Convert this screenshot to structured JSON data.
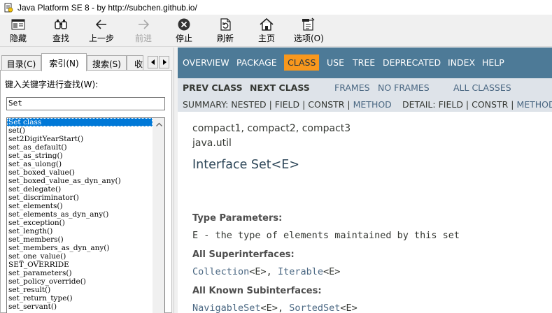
{
  "window": {
    "title": "Java Platform SE 8 - by http://subchen.github.io/"
  },
  "toolbar": {
    "buttons": [
      {
        "label": "隐藏",
        "icon": "hide-pane-icon",
        "enabled": true
      },
      {
        "label": "查找",
        "icon": "find-icon",
        "enabled": true
      },
      {
        "label": "上一步",
        "icon": "back-arrow-icon",
        "enabled": true
      },
      {
        "label": "前进",
        "icon": "forward-arrow-icon",
        "enabled": false
      },
      {
        "label": "停止",
        "icon": "stop-icon",
        "enabled": true
      },
      {
        "label": "刷新",
        "icon": "refresh-icon",
        "enabled": true
      },
      {
        "label": "主页",
        "icon": "home-icon",
        "enabled": true
      },
      {
        "label": "选项(O)",
        "icon": "options-icon",
        "enabled": true
      }
    ]
  },
  "left_pane": {
    "tabs": [
      {
        "label": "目录(C)",
        "active": false
      },
      {
        "label": "索引(N)",
        "active": true
      },
      {
        "label": "搜索(S)",
        "active": false
      },
      {
        "label": "收",
        "active": false
      }
    ],
    "keyword_label": "键入关键字进行查找(W):",
    "keyword_value": "Set",
    "index_items": [
      "Set class",
      "set()",
      "set2DigitYearStart()",
      "set_as_default()",
      "set_as_string()",
      "set_as_ulong()",
      "set_boxed_value()",
      "set_boxed_value_as_dyn_any()",
      "set_delegate()",
      "set_discriminator()",
      "set_elements()",
      "set_elements_as_dyn_any()",
      "set_exception()",
      "set_length()",
      "set_members()",
      "set_members_as_dyn_any()",
      "set_one_value()",
      "SET_OVERRIDE",
      "set_parameters()",
      "set_policy_override()",
      "set_result()",
      "set_return_type()",
      "set_servant()"
    ],
    "selected_index": 0
  },
  "doc": {
    "top_nav": [
      {
        "label": "OVERVIEW",
        "active": false
      },
      {
        "label": "PACKAGE",
        "active": false
      },
      {
        "label": "CLASS",
        "active": true
      },
      {
        "label": "USE",
        "active": false
      },
      {
        "label": "TREE",
        "active": false
      },
      {
        "label": "DEPRECATED",
        "active": false
      },
      {
        "label": "INDEX",
        "active": false
      },
      {
        "label": "HELP",
        "active": false
      }
    ],
    "sub_nav": {
      "prev_class": "PREV CLASS",
      "next_class": "NEXT CLASS",
      "frames": "FRAMES",
      "no_frames": "NO FRAMES",
      "all_classes": "ALL CLASSES",
      "summary_prefix": "SUMMARY: NESTED | FIELD | CONSTR |",
      "summary_method": "METHOD",
      "detail_prefix": "DETAIL: FIELD | CONSTR |",
      "detail_method": "METHOD"
    },
    "profiles": "compact1, compact2, compact3",
    "package": "java.util",
    "heading": "Interface Set<E>",
    "type_params_label": "Type Parameters:",
    "type_params_desc": "E - the type of elements maintained by this set",
    "superinterfaces_label": "All Superinterfaces:",
    "superinterfaces": [
      {
        "name": "Collection",
        "generic": "<E>"
      },
      {
        "name": "Iterable",
        "generic": "<E>"
      }
    ],
    "subinterfaces_label": "All Known Subinterfaces:",
    "subinterfaces": [
      {
        "name": "NavigableSet",
        "generic": "<E>"
      },
      {
        "name": "SortedSet",
        "generic": "<E>"
      }
    ]
  },
  "colors": {
    "nav_bar": "#4d7a97",
    "nav_active": "#f8981d",
    "sub_nav": "#dee3e9",
    "link": "#4a6782",
    "selection": "#0078d7"
  }
}
